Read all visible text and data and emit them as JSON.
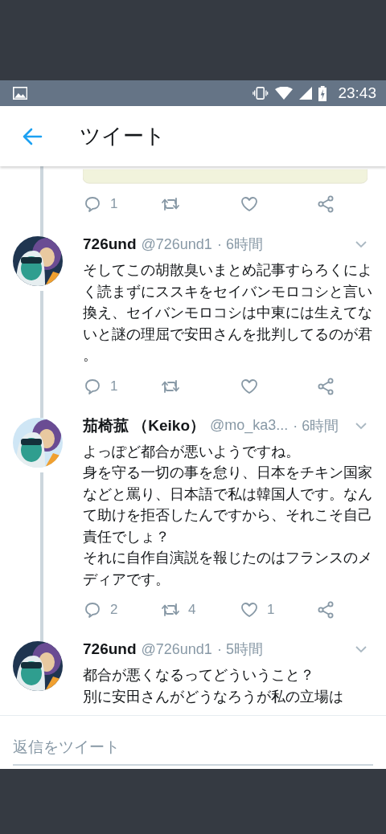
{
  "status_bar": {
    "time": "23:43"
  },
  "header": {
    "title": "ツイート"
  },
  "previous_tweet": {
    "media": {
      "kind": "picture"
    },
    "actions": [
      {
        "kind": "reply",
        "count": "1"
      },
      {
        "kind": "retweet"
      },
      {
        "kind": "like"
      },
      {
        "kind": "share"
      }
    ]
  },
  "tweets": [
    {
      "avatar": {
        "kind": "picture",
        "color": "#1f3550"
      },
      "name": "726und",
      "handle": "@726und1",
      "time": "· 6時間",
      "body": [
        "そしてこの胡散臭いまとめ記事すらろくによく読まずにススキをセイバンモロコシと言い換え、セイバンモロコシは中東には生えてないと謎の理屈で安田さんを批判してるのが君。"
      ],
      "actions": [
        {
          "kind": "reply",
          "count": "1"
        },
        {
          "kind": "retweet"
        },
        {
          "kind": "like"
        },
        {
          "kind": "share"
        }
      ]
    },
    {
      "avatar": {
        "kind": "picture",
        "color": "#cfe6f5"
      },
      "name": "茄椅菰 （Keiko）",
      "handle": "@mo_ka3...",
      "time": "· 6時間",
      "body": [
        "よっぽど都合が悪いようですね。",
        "身を守る一切の事を怠り、日本をチキン国家などと罵り、日本語で私は韓国人です。なんて助けを拒否したんですから、それこそ自己責任でしょ？",
        "それに自作自演説を報じたのはフランスのメディアです。"
      ],
      "actions": [
        {
          "kind": "reply",
          "count": "2"
        },
        {
          "kind": "retweet",
          "count": "4"
        },
        {
          "kind": "like",
          "count": "1"
        },
        {
          "kind": "share"
        }
      ]
    },
    {
      "avatar": {
        "kind": "picture",
        "color": "#1f3550"
      },
      "name": "726und",
      "handle": "@726und1",
      "time": "· 5時間",
      "body": [
        "都合が悪くなるってどういうこと？",
        "別に安田さんがどうなろうが私の立場は"
      ]
    }
  ],
  "reply_box": {
    "placeholder": "返信をツイート"
  }
}
